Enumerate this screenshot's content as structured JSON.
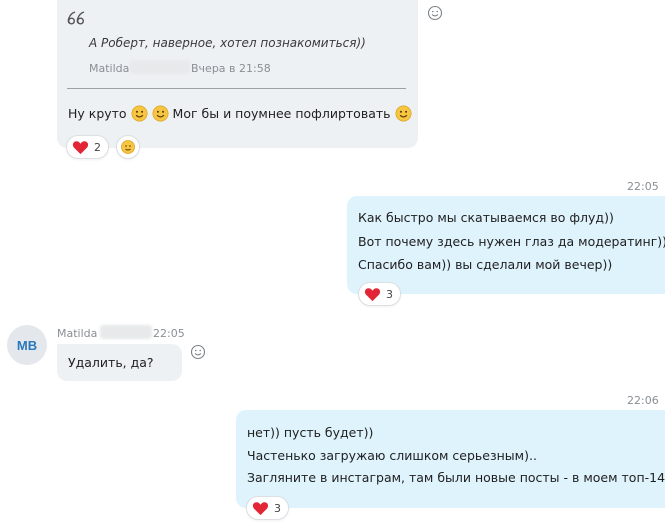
{
  "messages": {
    "m1": {
      "quote": {
        "text": "А Роберт, наверное, хотел познакомиться))",
        "author": "Matilda",
        "time": "Вчера в 21:58"
      },
      "text_parts": [
        "Ну круто",
        "Мог бы и поумнее пофлиртовать"
      ],
      "reactions": {
        "heart_count": "2"
      }
    },
    "m2": {
      "time": "22:05",
      "lines": [
        "Как быстро мы скатываемся во флуд))",
        "Вот почему здесь нужен глаз да модератинг))",
        "Спасибо вам)) вы сделали мой вечер))"
      ],
      "reactions": {
        "heart_count": "3"
      }
    },
    "m3": {
      "avatar": "MB",
      "sender": "Matilda",
      "time": "22:05",
      "text": "Удалить, да?"
    },
    "m4": {
      "time": "22:06",
      "lines": [
        "нет)) пусть будет))",
        "Частенько загружаю слишком серьезным)..",
        "Загляните в инстаграм, там были новые посты - в моем топ-14"
      ],
      "reactions": {
        "heart_count": "3"
      }
    }
  },
  "icons": {
    "quote": "quote-icon",
    "emoji": "smiley-icon",
    "heart": "heart-icon",
    "add_reaction": "add-reaction-icon"
  },
  "colors": {
    "incoming_bubble": "#eef1f4",
    "outgoing_bubble": "#dff3fd",
    "heart": "#e32636",
    "avatar_text": "#2878bd"
  }
}
